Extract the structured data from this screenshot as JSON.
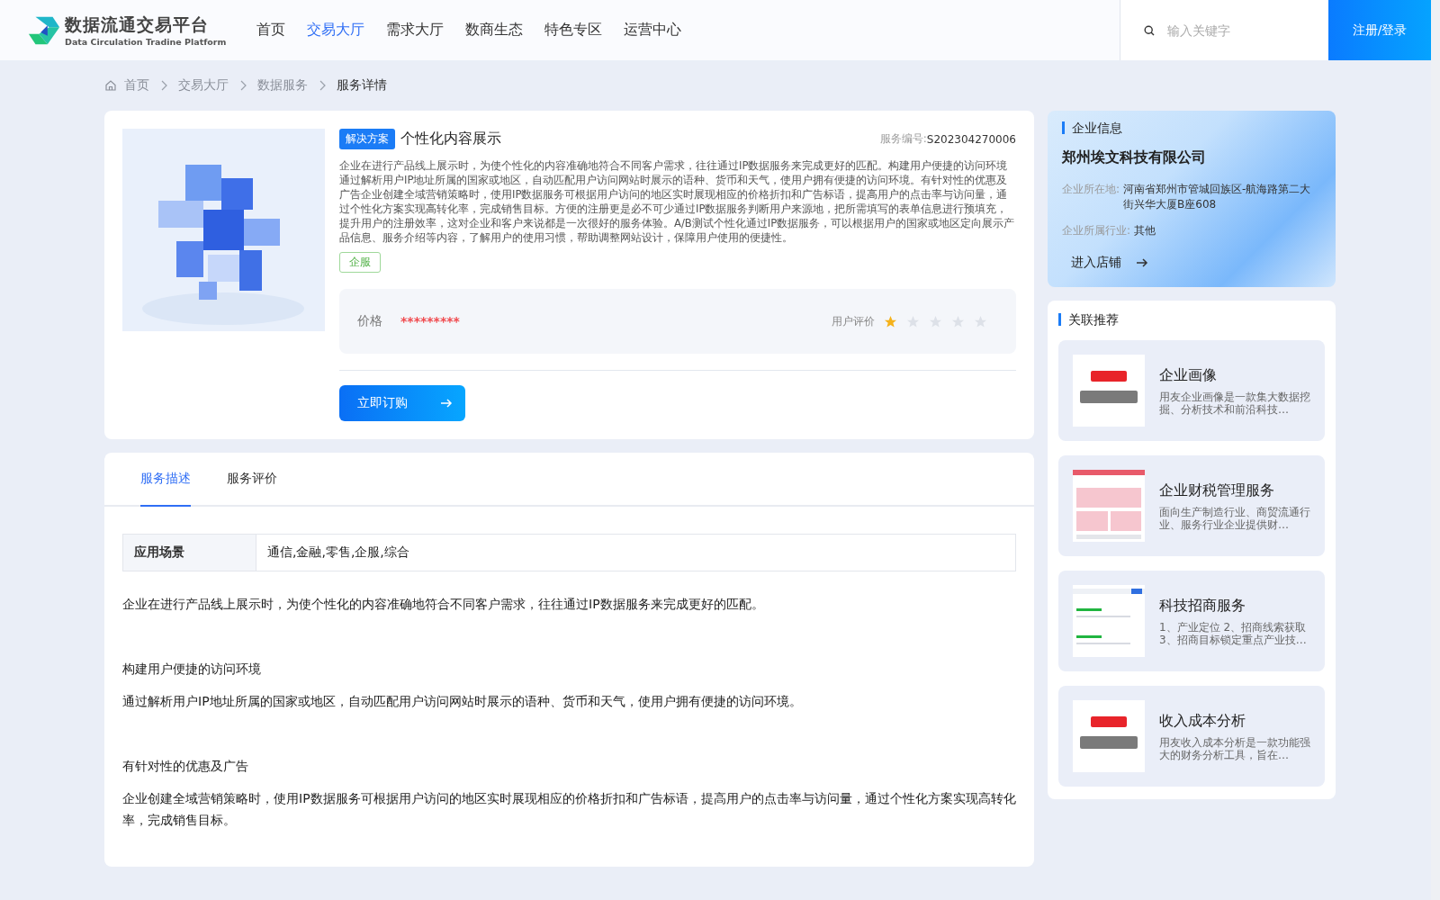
{
  "header": {
    "logo_title": "数据流通交易平台",
    "logo_subtitle": "Data Circulation Tradine Platform",
    "nav": [
      {
        "label": "首页",
        "selected": false
      },
      {
        "label": "交易大厅",
        "selected": true
      },
      {
        "label": "需求大厅",
        "selected": false
      },
      {
        "label": "数商生态",
        "selected": false
      },
      {
        "label": "特色专区",
        "selected": false
      },
      {
        "label": "运营中心",
        "selected": false
      }
    ],
    "search": {
      "placeholder": "输入关键字"
    },
    "login_button": "注册/登录"
  },
  "breadcrumb": [
    "首页",
    "交易大厅",
    "数据服务",
    "服务详情"
  ],
  "product": {
    "badge": "解决方案",
    "title": "个性化内容展示",
    "code_label": "服务编号:",
    "code": "S202304270006",
    "description": "企业在进行产品线上展示时，为使个性化的内容准确地符合不同客户需求，往往通过IP数据服务来完成更好的匹配。构建用户便捷的访问环境通过解析用户IP地址所属的国家或地区，自动匹配用户访问网站时展示的语种、货币和天气，使用户拥有便捷的访问环境。有针对性的优惠及广告企业创建全域营销策略时，使用IP数据服务可根据用户访问的地区实时展现相应的价格折扣和广告标语，提高用户的点击率与访问量，通过个性化方案实现高转化率，完成销售目标。方便的注册更是必不可少通过IP数据服务判断用户来源地，把所需填写的表单信息进行预填充，提升用户的注册效率，这对企业和客户来说都是一次很好的服务体验。A/B测试个性化通过IP数据服务，可以根据用户的国家或地区定向展示产品信息、服务介绍等内容，了解用户的使用习惯，帮助调整网站设计，保障用户使用的便捷性。",
    "tag": "企服",
    "price_label": "价格",
    "price": "*********",
    "rating_label": "用户评价",
    "rating": {
      "stars": 1
    },
    "buy_button": "立即订购"
  },
  "detail": {
    "tabs": [
      {
        "label": "服务描述",
        "selected": true
      },
      {
        "label": "服务评价",
        "selected": false
      }
    ],
    "scene_label": "应用场景",
    "scene_value": "通信,金融,零售,企服,综合",
    "blocks": [
      {
        "kind": "paragraph",
        "text": "企业在进行产品线上展示时，为使个性化的内容准确地符合不同客户需求，往往通过IP数据服务来完成更好的匹配。"
      },
      {
        "kind": "heading",
        "text": "构建用户便捷的访问环境"
      },
      {
        "kind": "paragraph",
        "text": "通过解析用户IP地址所属的国家或地区，自动匹配用户访问网站时展示的语种、货币和天气，使用户拥有便捷的访问环境。"
      },
      {
        "kind": "heading",
        "text": "有针对性的优惠及广告"
      },
      {
        "kind": "paragraph",
        "text": "企业创建全域营销策略时，使用IP数据服务可根据用户访问的地区实时展现相应的价格折扣和广告标语，提高用户的点击率与访问量，通过个性化方案实现高转化率，完成销售目标。"
      }
    ]
  },
  "company": {
    "section_title": "企业信息",
    "name": "郑州埃文科技有限公司",
    "location_label": "企业所在地:",
    "location": "河南省郑州市管城回族区-航海路第二大街兴华大厦B座608",
    "industry_label": "企业所属行业:",
    "industry": "其他",
    "enter_button": "进入店铺"
  },
  "recommendations": {
    "section_title": "关联推荐",
    "items": [
      {
        "title": "企业画像",
        "summary": "用友企业画像是一款集大数据挖掘、分析技术和前沿科技…"
      },
      {
        "title": "企业财税管理服务",
        "summary": "面向生产制造行业、商贸流通行业、服务行业企业提供财…"
      },
      {
        "title": "科技招商服务",
        "summary": "1、产业定位 2、招商线索获取 3、招商目标锁定重点产业技…"
      },
      {
        "title": "收入成本分析",
        "summary": "用友收入成本分析是一款功能强大的财务分析工具，旨在…"
      }
    ]
  }
}
